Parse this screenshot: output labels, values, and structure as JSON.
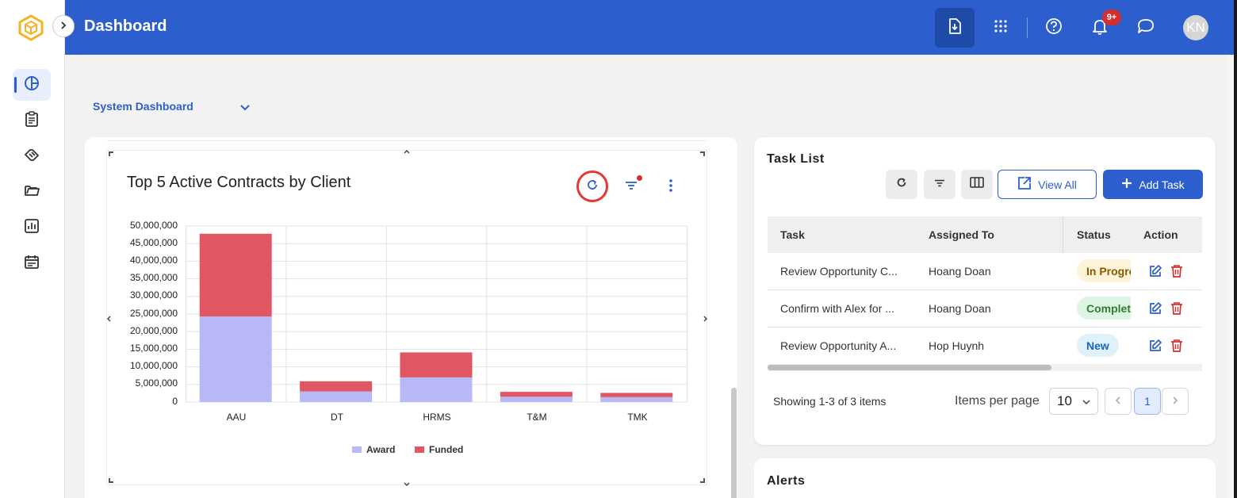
{
  "header": {
    "title": "Dashboard",
    "notification_count": "9+",
    "avatar_initials": "KN",
    "icons": [
      "download-icon",
      "apps-grid-icon",
      "help-icon",
      "bell-icon",
      "chat-icon"
    ]
  },
  "sidebar": {
    "items": [
      {
        "name": "dashboard",
        "icon": "pie-chart-icon",
        "active": true
      },
      {
        "name": "contracts",
        "icon": "clipboard-icon"
      },
      {
        "name": "deals",
        "icon": "handshake-icon"
      },
      {
        "name": "documents",
        "icon": "folder-icon"
      },
      {
        "name": "reports",
        "icon": "bar-report-icon"
      },
      {
        "name": "calendar",
        "icon": "calendar-icon"
      }
    ]
  },
  "dashboard_selector": {
    "label": "System Dashboard"
  },
  "chart_widget": {
    "title": "Top 5 Active Contracts by Client"
  },
  "chart_data": {
    "type": "bar",
    "stacked": true,
    "title": "Top 5 Active Contracts by Client",
    "categories": [
      "AAU",
      "DT",
      "HRMS",
      "T&M",
      "TMK"
    ],
    "series": [
      {
        "name": "Award",
        "color": "#b8b8f6",
        "values": [
          24300000,
          3000000,
          7000000,
          1500000,
          1400000
        ]
      },
      {
        "name": "Funded",
        "color": "#e05663",
        "values": [
          23500000,
          2900000,
          7100000,
          1400000,
          1200000
        ]
      }
    ],
    "y_ticks": [
      "50,000,000",
      "45,000,000",
      "40,000,000",
      "35,000,000",
      "30,000,000",
      "25,000,000",
      "20,000,000",
      "15,000,000",
      "10,000,000",
      "5,000,000",
      "0"
    ],
    "ylim": [
      0,
      50000000
    ],
    "grid": true,
    "legend": "bottom"
  },
  "task_list": {
    "title": "Task List",
    "view_all_label": "View All",
    "add_task_label": "Add Task",
    "columns": [
      "Task",
      "Assigned To",
      "Status",
      "Action"
    ],
    "rows": [
      {
        "task": "Review Opportunity C...",
        "assigned": "Hoang Doan",
        "status": "In Progress",
        "status_bg": "#fdf3d8",
        "status_fg": "#8a5a00"
      },
      {
        "task": "Confirm with Alex for ...",
        "assigned": "Hoang Doan",
        "status": "Completed",
        "status_bg": "#dff5e3",
        "status_fg": "#2e7d32"
      },
      {
        "task": "Review Opportunity A...",
        "assigned": "Hop Huynh",
        "status": "New",
        "status_bg": "#e1f1fc",
        "status_fg": "#1565c0"
      }
    ],
    "showing_text": "Showing 1-3 of 3 items",
    "items_per_page_label": "Items per page",
    "items_per_page_value": "10",
    "current_page": "1"
  },
  "alerts": {
    "title": "Alerts"
  },
  "colors": {
    "header": "#2c5fcd",
    "accent": "#2c5fcd",
    "delete": "#d32f2f"
  }
}
